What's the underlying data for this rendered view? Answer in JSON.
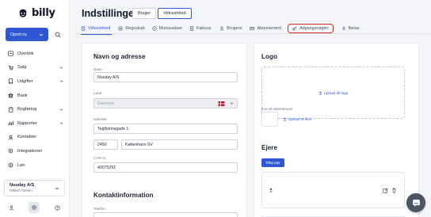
{
  "app": {
    "brand": "billy"
  },
  "sidebar": {
    "create_label": "Opret ny",
    "items": [
      {
        "label": "Overblik",
        "icon": "dashboard-icon",
        "chevron": false
      },
      {
        "label": "Salg",
        "icon": "cart-icon",
        "chevron": true
      },
      {
        "label": "Udgifter",
        "icon": "receipt-icon",
        "chevron": true
      },
      {
        "label": "Bank",
        "icon": "bank-icon",
        "chevron": false
      },
      {
        "label": "Bogføring",
        "icon": "book-icon",
        "chevron": true
      },
      {
        "label": "Rapporter",
        "icon": "report-icon",
        "chevron": true
      },
      {
        "label": "Kontakter",
        "icon": "contacts-icon",
        "chevron": false
      },
      {
        "label": "Integrationer",
        "icon": "plug-icon",
        "chevron": false
      },
      {
        "label": "Løn",
        "icon": "coin-icon",
        "chevron": false
      }
    ],
    "company": {
      "name": "Nuuday A/S",
      "user": "Mikkel Olesen"
    }
  },
  "header": {
    "title": "Indstillinger",
    "toggle": [
      "Bruger",
      "Virksomhed"
    ],
    "toggle_selected": 1
  },
  "tabs": [
    {
      "label": "Virksomhed",
      "icon": "building-icon"
    },
    {
      "label": "Regnskab",
      "icon": "ledger-icon"
    },
    {
      "label": "Momssatser",
      "icon": "percent-icon"
    },
    {
      "label": "Faktura",
      "icon": "invoice-icon"
    },
    {
      "label": "Brugere",
      "icon": "user-icon"
    },
    {
      "label": "Abonnement",
      "icon": "subscription-icon"
    },
    {
      "label": "Adgangsnøgler",
      "icon": "key-icon"
    },
    {
      "label": "Betas",
      "icon": "bulb-icon"
    }
  ],
  "active_tab": 0,
  "highlighted_tab": 6,
  "address": {
    "section_title": "Navn og adresse",
    "name_label": "Navn",
    "name_value": "Nuuday A/S",
    "country_label": "Land",
    "country_value": "Danmark",
    "address_label": "Adresse",
    "street_value": "Teglholmsgade 1.",
    "zip_value": "2450",
    "city_value": "København SV",
    "cvr_label": "CVR-nr.",
    "cvr_value": "40075291"
  },
  "contact": {
    "section_title": "Kontaktinformation",
    "phone_label": "Telefon"
  },
  "logo": {
    "section_title": "Logo",
    "upload_label": "Upload dit logo",
    "icon_label": "Ikon til sidemenuen",
    "icon_upload_label": "Upload et ikon"
  },
  "owners": {
    "section_title": "Ejere",
    "add_label": "Tilføj ejer"
  },
  "colors": {
    "accent": "#2f57d4",
    "highlight": "#d0271d"
  }
}
